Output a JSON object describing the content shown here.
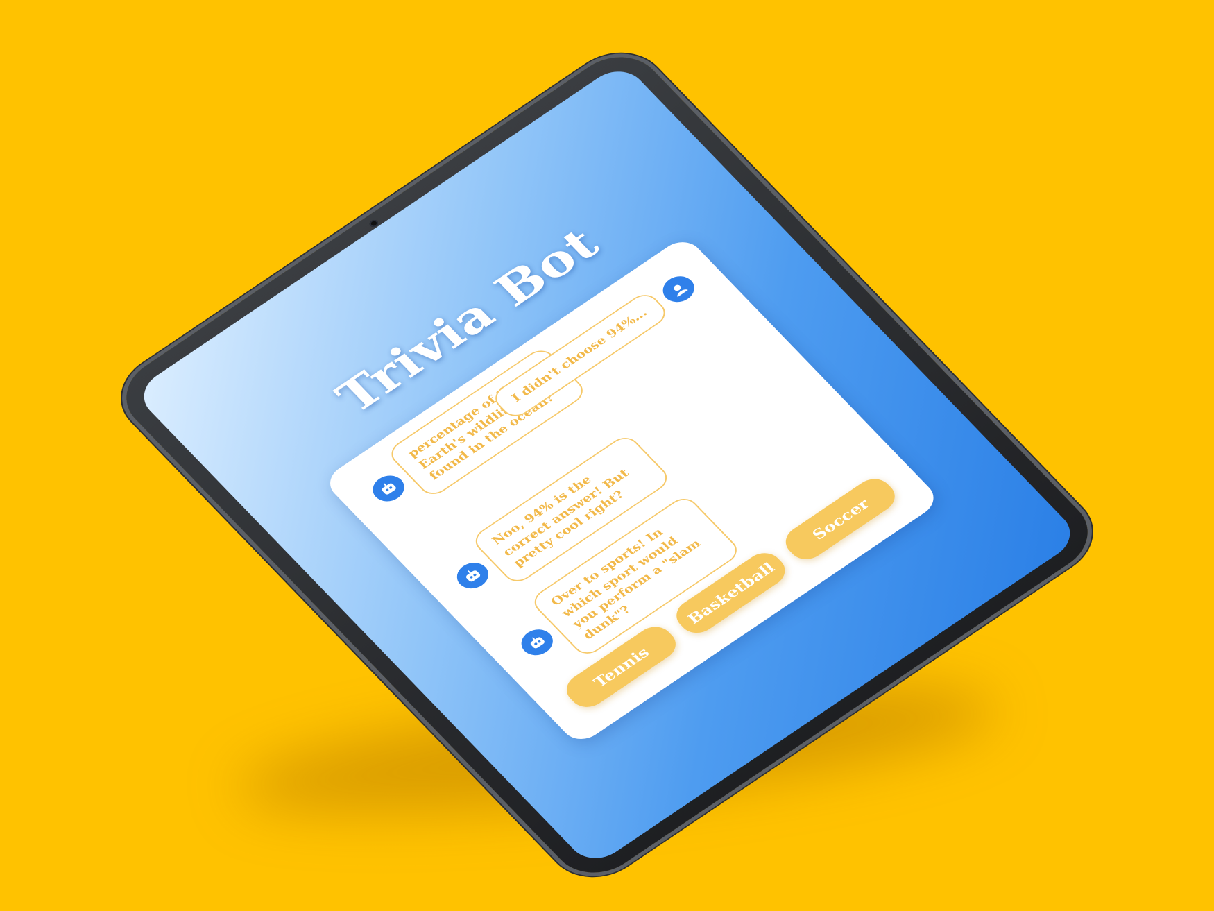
{
  "app": {
    "title": "Trivia Bot"
  },
  "chat": {
    "messages": [
      {
        "sender": "bot",
        "text": "percentage of the Earth's wildlife is found in the ocean?"
      },
      {
        "sender": "user",
        "text": "I didn't choose 94%..."
      },
      {
        "sender": "bot",
        "text": "Noo, 94% is the correct answer! But pretty cool right?"
      },
      {
        "sender": "bot",
        "text": "Over to sports! In which sport would you perform a \"slam dunk\"?"
      }
    ],
    "avatar_icon": "robot-face-icon"
  },
  "answers": [
    "Tennis",
    "Basketball",
    "Soccer"
  ],
  "colors": {
    "background": "#FFC200",
    "screen_gradient_start": "#dceeff",
    "screen_gradient_end": "#2a7fe6",
    "bubble_text": "#F2B94A",
    "button": "#F7C95E",
    "avatar": "#2f80ea"
  }
}
